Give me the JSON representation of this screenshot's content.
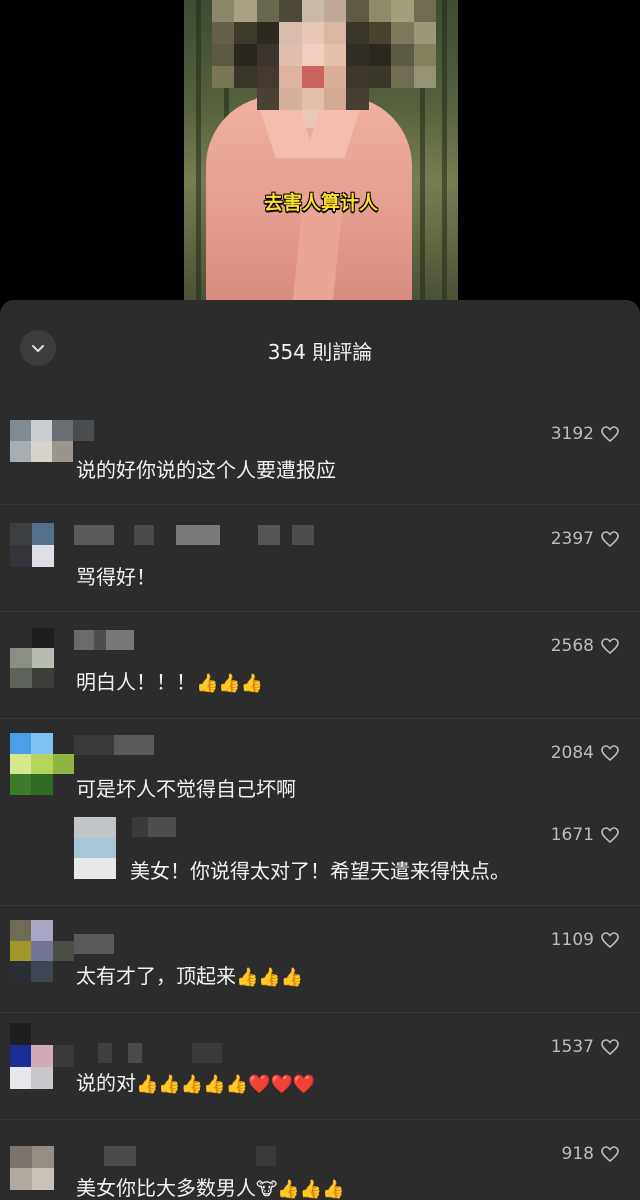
{
  "video": {
    "caption": "去害人算计人"
  },
  "comments_panel": {
    "title": "354 則評論",
    "collapse_icon": "chevron-down-icon",
    "comments": [
      {
        "text": "说的好你说的这个人要遭报应",
        "likes": "3192"
      },
      {
        "text": "骂得好！",
        "likes": "2397"
      },
      {
        "text": "明白人！！！",
        "emoji": "👍👍👍",
        "likes": "2568"
      },
      {
        "text": "可是坏人不觉得自己坏啊",
        "likes": "2084"
      },
      {
        "text": "美女！你说得太对了！希望天遣来得快点。",
        "likes": "1671",
        "reply": true
      },
      {
        "text": "太有才了，顶起来",
        "emoji": "👍👍👍",
        "likes": "1109"
      },
      {
        "text": "说的对",
        "emoji": "👍👍👍👍👍❤️❤️❤️",
        "likes": "1537"
      },
      {
        "text": "美女你比大多数男人",
        "emoji": "🐮👍👍👍",
        "likes": "918"
      }
    ]
  },
  "colors": {
    "sheet_bg": "#2c2c2c",
    "caption_yellow": "#ffdf2b",
    "text": "#f2f2f2",
    "muted": "#bdbdbd"
  }
}
